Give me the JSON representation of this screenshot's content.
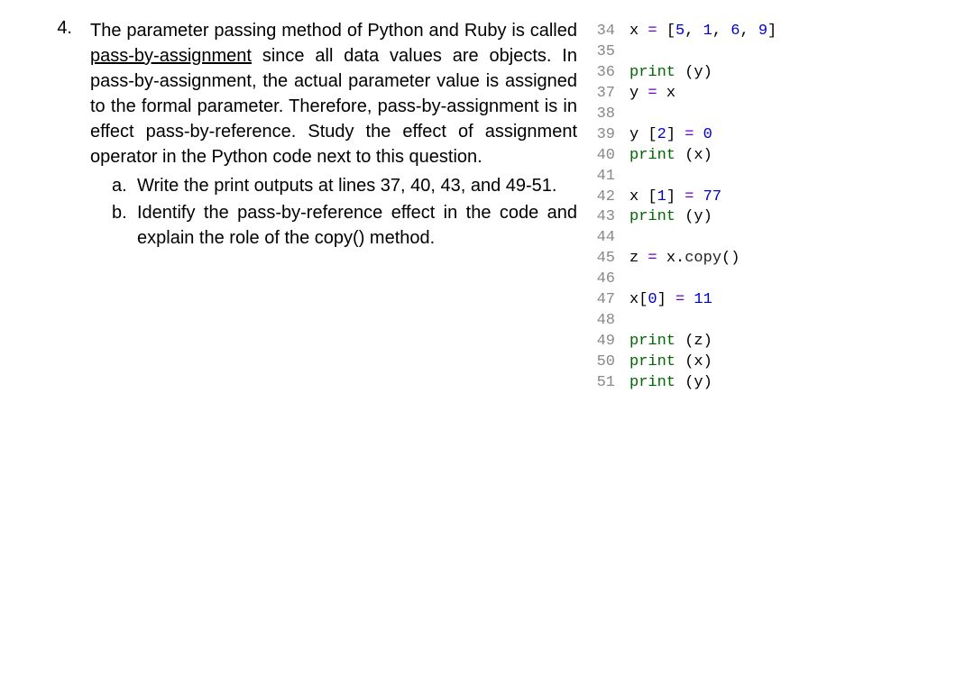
{
  "question": {
    "number": "4.",
    "text_before_underline": "The parameter passing method of Python and Ruby is called ",
    "underline_text": "pass-by-assignment",
    "text_after_underline": " since all data values are objects. In pass-by-assignment, the actual parameter value is assigned to the formal parameter. Therefore, pass-by-assignment is in effect pass-by-reference. Study the effect of assignment operator in the Python code next to this question.",
    "sub_items": [
      {
        "marker": "a.",
        "text": "Write the print outputs at lines 37, 40, 43, and 49-51."
      },
      {
        "marker": "b.",
        "text": "Identify the pass-by-reference effect in the code and explain the role of the copy() method."
      }
    ]
  },
  "code": {
    "lines": [
      {
        "num": "34",
        "tokens": [
          {
            "t": "x ",
            "c": "c-black"
          },
          {
            "t": "= ",
            "c": "c-purple"
          },
          {
            "t": "[",
            "c": "c-black"
          },
          {
            "t": "5",
            "c": "c-blue"
          },
          {
            "t": ", ",
            "c": "c-black"
          },
          {
            "t": "1",
            "c": "c-blue"
          },
          {
            "t": ", ",
            "c": "c-black"
          },
          {
            "t": "6",
            "c": "c-blue"
          },
          {
            "t": ", ",
            "c": "c-black"
          },
          {
            "t": "9",
            "c": "c-blue"
          },
          {
            "t": "]",
            "c": "c-black"
          }
        ]
      },
      {
        "num": "35",
        "tokens": []
      },
      {
        "num": "36",
        "tokens": [
          {
            "t": "print ",
            "c": "c-green"
          },
          {
            "t": "(y)",
            "c": "c-black"
          }
        ]
      },
      {
        "num": "37",
        "tokens": [
          {
            "t": "y ",
            "c": "c-black"
          },
          {
            "t": "= ",
            "c": "c-purple"
          },
          {
            "t": "x",
            "c": "c-black"
          }
        ]
      },
      {
        "num": "38",
        "tokens": []
      },
      {
        "num": "39",
        "tokens": [
          {
            "t": "y ",
            "c": "c-black"
          },
          {
            "t": "[",
            "c": "c-black"
          },
          {
            "t": "2",
            "c": "c-blue"
          },
          {
            "t": "] ",
            "c": "c-black"
          },
          {
            "t": "= ",
            "c": "c-purple"
          },
          {
            "t": "0",
            "c": "c-blue"
          }
        ]
      },
      {
        "num": "40",
        "tokens": [
          {
            "t": "print ",
            "c": "c-green"
          },
          {
            "t": "(x)",
            "c": "c-black"
          }
        ]
      },
      {
        "num": "41",
        "tokens": []
      },
      {
        "num": "42",
        "tokens": [
          {
            "t": "x ",
            "c": "c-black"
          },
          {
            "t": "[",
            "c": "c-black"
          },
          {
            "t": "1",
            "c": "c-blue"
          },
          {
            "t": "] ",
            "c": "c-black"
          },
          {
            "t": "= ",
            "c": "c-purple"
          },
          {
            "t": "77",
            "c": "c-blue"
          }
        ]
      },
      {
        "num": "43",
        "tokens": [
          {
            "t": "print ",
            "c": "c-green"
          },
          {
            "t": "(y)",
            "c": "c-black"
          }
        ]
      },
      {
        "num": "44",
        "tokens": []
      },
      {
        "num": "45",
        "tokens": [
          {
            "t": "z ",
            "c": "c-black"
          },
          {
            "t": "= ",
            "c": "c-purple"
          },
          {
            "t": "x",
            "c": "c-black"
          },
          {
            "t": ".",
            "c": "c-black"
          },
          {
            "t": "copy",
            "c": "c-dark"
          },
          {
            "t": "()",
            "c": "c-black"
          }
        ]
      },
      {
        "num": "46",
        "tokens": []
      },
      {
        "num": "47",
        "tokens": [
          {
            "t": "x",
            "c": "c-black"
          },
          {
            "t": "[",
            "c": "c-black"
          },
          {
            "t": "0",
            "c": "c-blue"
          },
          {
            "t": "] ",
            "c": "c-black"
          },
          {
            "t": "= ",
            "c": "c-purple"
          },
          {
            "t": "11",
            "c": "c-blue"
          }
        ]
      },
      {
        "num": "48",
        "tokens": []
      },
      {
        "num": "49",
        "tokens": [
          {
            "t": "print ",
            "c": "c-green"
          },
          {
            "t": "(z)",
            "c": "c-black"
          }
        ]
      },
      {
        "num": "50",
        "tokens": [
          {
            "t": "print ",
            "c": "c-green"
          },
          {
            "t": "(x)",
            "c": "c-black"
          }
        ]
      },
      {
        "num": "51",
        "tokens": [
          {
            "t": "print ",
            "c": "c-green"
          },
          {
            "t": "(y)",
            "c": "c-black"
          }
        ]
      }
    ]
  }
}
